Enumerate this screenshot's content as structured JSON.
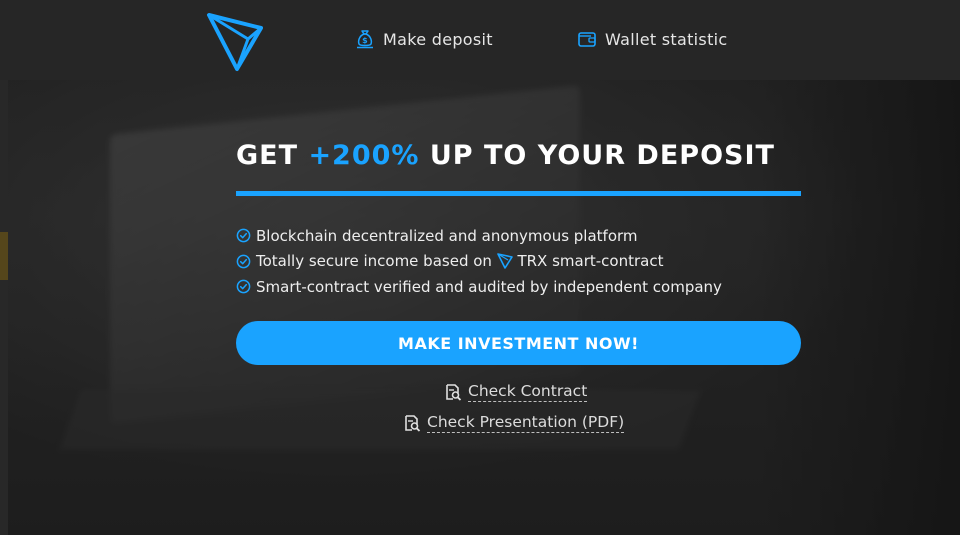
{
  "header": {
    "logo_icon": "tron-logo-icon",
    "nav": [
      {
        "label": "Make deposit",
        "icon": "money-bag-icon"
      },
      {
        "label": "Wallet statistic",
        "icon": "wallet-icon"
      }
    ]
  },
  "hero": {
    "title_prefix": "GET ",
    "title_accent": "+200%",
    "title_suffix": " UP TO YOUR DEPOSIT",
    "features": [
      {
        "text": "Blockchain decentralized and anonymous platform",
        "icon": "check-circle-icon"
      },
      {
        "text_before": "Totally secure income based on ",
        "inline_icon": "trx-icon",
        "text_after": "TRX smart-contract",
        "icon": "check-circle-icon"
      },
      {
        "text": "Smart-contract verified and audited by independent company",
        "icon": "check-circle-icon"
      }
    ],
    "cta_label": "MAKE INVESTMENT NOW!",
    "links": [
      {
        "label": "Check Contract",
        "icon": "document-search-icon"
      },
      {
        "label": "Check Presentation (PDF)",
        "icon": "document-search-icon"
      }
    ]
  },
  "colors": {
    "accent": "#1aa3ff",
    "header_bg": "#262626",
    "text": "#ffffff"
  }
}
